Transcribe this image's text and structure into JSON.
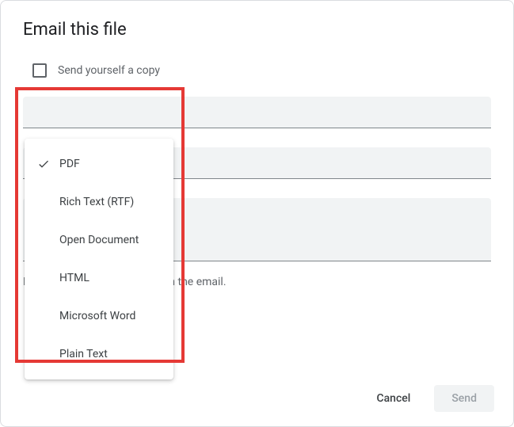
{
  "dialog": {
    "title": "Email this file"
  },
  "checkbox": {
    "label": "Send yourself a copy"
  },
  "hint": {
    "text": "Don't attach. Include content in the email."
  },
  "format": {
    "selected": "PDF",
    "options": {
      "0": "PDF",
      "1": "Rich Text (RTF)",
      "2": "Open Document",
      "3": "HTML",
      "4": "Microsoft Word",
      "5": "Plain Text"
    }
  },
  "actions": {
    "cancel": "Cancel",
    "send": "Send"
  }
}
